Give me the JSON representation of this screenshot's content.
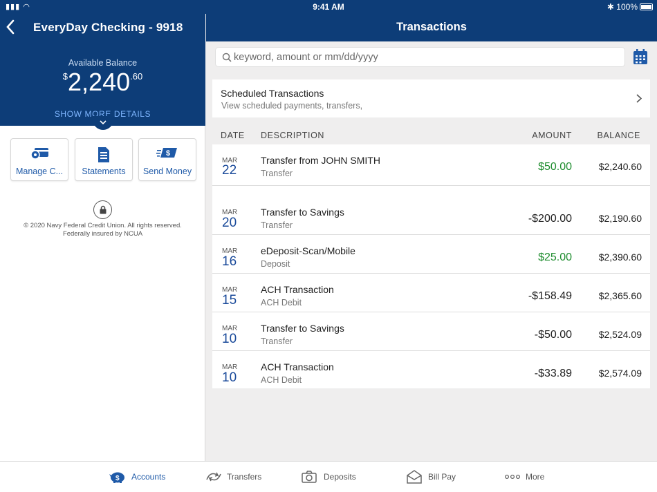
{
  "status": {
    "time": "9:41 AM",
    "battery": "100%"
  },
  "account": {
    "title": "EveryDay Checking - 9918",
    "available_label": "Available Balance",
    "balance_currency": "$",
    "balance_whole": "2,240",
    "balance_cents": ".60",
    "show_more": "SHOW MORE DETAILS"
  },
  "tiles": [
    {
      "label": "Manage C...",
      "icon": "manage-card-icon"
    },
    {
      "label": "Statements",
      "icon": "statement-document-icon"
    },
    {
      "label": "Send Money",
      "icon": "send-money-icon"
    }
  ],
  "footer": {
    "line1": "© 2020 Navy Federal Credit Union. All rights reserved.",
    "line2": "Federally insured by NCUA"
  },
  "header": {
    "title": "Transactions"
  },
  "search": {
    "placeholder": "keyword, amount or mm/dd/yyyy"
  },
  "scheduled": {
    "title": "Scheduled Transactions",
    "subtitle": "View scheduled payments, transfers,"
  },
  "table": {
    "headers": {
      "date": "DATE",
      "description": "DESCRIPTION",
      "amount": "AMOUNT",
      "balance": "BALANCE"
    },
    "rows": [
      {
        "month": "MAR",
        "day": "22",
        "desc": "Transfer from JOHN SMITH",
        "type": "Transfer",
        "amount": "$50.00",
        "credit": true,
        "balance": "$2,240.60"
      },
      {
        "month": "MAR",
        "day": "20",
        "desc": "Transfer to Savings",
        "type": "Transfer",
        "amount": "-$200.00",
        "credit": false,
        "balance": "$2,190.60"
      },
      {
        "month": "MAR",
        "day": "16",
        "desc": "eDeposit-Scan/Mobile",
        "type": "Deposit",
        "amount": "$25.00",
        "credit": true,
        "balance": "$2,390.60"
      },
      {
        "month": "MAR",
        "day": "15",
        "desc": "ACH Transaction",
        "type": "ACH Debit",
        "amount": "-$158.49",
        "credit": false,
        "balance": "$2,365.60"
      },
      {
        "month": "MAR",
        "day": "10",
        "desc": "Transfer to Savings",
        "type": "Transfer",
        "amount": "-$50.00",
        "credit": false,
        "balance": "$2,524.09"
      },
      {
        "month": "MAR",
        "day": "10",
        "desc": "ACH Transaction",
        "type": "ACH Debit",
        "amount": "-$33.89",
        "credit": false,
        "balance": "$2,574.09"
      }
    ]
  },
  "tabbar": [
    {
      "label": "Accounts",
      "icon": "piggy-bank-icon",
      "active": true
    },
    {
      "label": "Transfers",
      "icon": "transfer-arrows-icon",
      "active": false
    },
    {
      "label": "Deposits",
      "icon": "camera-icon",
      "active": false
    },
    {
      "label": "Bill Pay",
      "icon": "envelope-icon",
      "active": false
    },
    {
      "label": "More",
      "icon": "more-dots-icon",
      "active": false
    }
  ],
  "colors": {
    "navy": "#0d3d78",
    "link": "#1f5aa8",
    "credit": "#1e8c2e"
  }
}
